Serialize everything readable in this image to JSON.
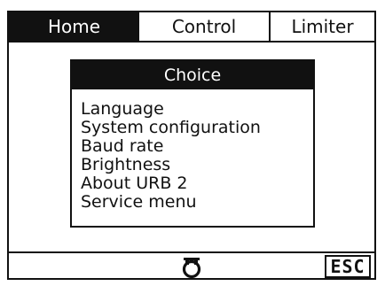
{
  "tabs": [
    {
      "label": "Home",
      "active": true
    },
    {
      "label": "Control",
      "active": false
    },
    {
      "label": "Limiter",
      "active": false
    }
  ],
  "dialog": {
    "title": "Choice",
    "items": [
      "Language",
      "System configuration",
      "Baud rate",
      "Brightness",
      "About URB 2",
      "Service menu"
    ]
  },
  "footer": {
    "rotate_icon": "rotary-encoder-icon",
    "esc_label": "ESC"
  },
  "colors": {
    "foreground": "#111111",
    "background": "#ffffff"
  }
}
